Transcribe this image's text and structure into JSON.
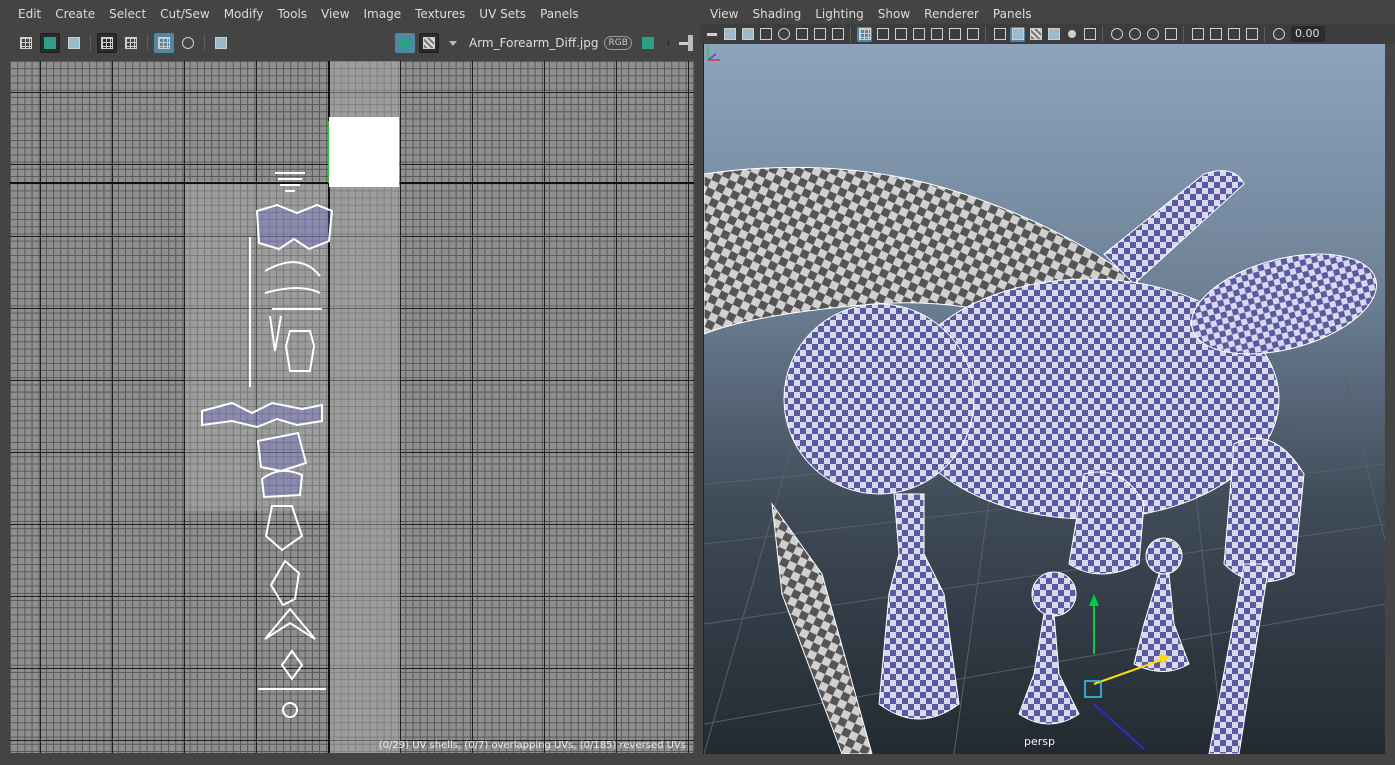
{
  "uv_editor": {
    "menu": [
      "Edit",
      "Create",
      "Select",
      "Cut/Sew",
      "Modify",
      "Tools",
      "View",
      "Image",
      "Textures",
      "UV Sets",
      "Panels"
    ],
    "toolbar": {
      "texture_name": "Arm_Forearm_Diff.jpg",
      "channel": "RGB",
      "icons": [
        "uv-grid-icon",
        "shaded-uv-icon",
        "distortion-icon",
        "uv-borders-icon",
        "texture-borders-icon",
        "grid-toggle-icon",
        "pixel-snap-icon",
        "snapshot-icon",
        "display-image-icon",
        "checker-icon",
        "exposure-icon"
      ]
    },
    "status_text": "(0/29) UV shells, (0/7) overlapping UVs, (0/185) reversed UVs"
  },
  "viewport": {
    "menu": [
      "View",
      "Shading",
      "Lighting",
      "Show",
      "Renderer",
      "Panels"
    ],
    "toolbar": {
      "value": "0.00",
      "icons": [
        "camera-icon",
        "bookmark-icon",
        "image-plane-icon",
        "grid-icon",
        "film-gate-icon",
        "resolution-gate-icon",
        "wireframe-icon",
        "smooth-shade-icon",
        "textured-icon",
        "lights-icon",
        "shadows-icon",
        "isolate-icon",
        "xray-icon",
        "exposure-icon"
      ]
    },
    "camera_label": "persp"
  },
  "colors": {
    "panel_bg": "#444444",
    "active_button": "#5285a6",
    "uv_lines": "#ffffff",
    "checker_blue": "#5a5aa0",
    "manipulator_y": "#00cc44",
    "manipulator_x": "#ffdd00"
  }
}
